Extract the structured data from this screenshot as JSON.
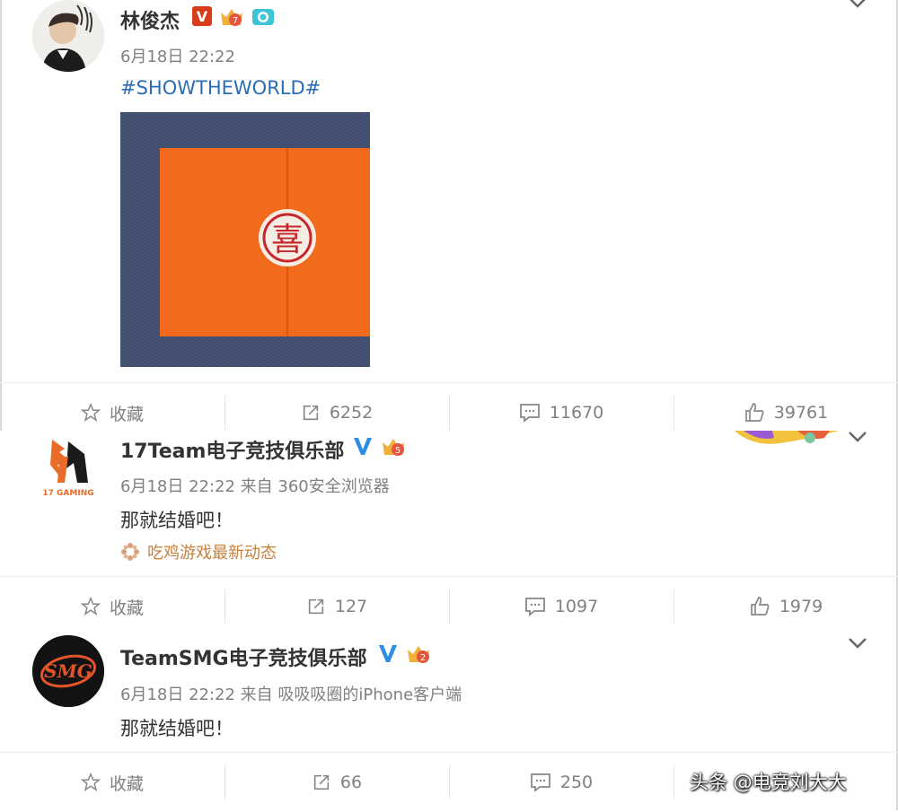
{
  "posts": [
    {
      "author": "林俊杰",
      "time": "6月18日 22:22",
      "source": "",
      "text": "#SHOWTHEWORLD#",
      "image_caption": "喜",
      "actions": {
        "favorite": "收藏",
        "repost": "6252",
        "comment": "11670",
        "like": "39761"
      },
      "level": "7"
    },
    {
      "author": "17Team电子竞技俱乐部",
      "time": "6月18日 22:22 来自 360安全浏览器",
      "text": "那就结婚吧！",
      "topic": "吃鸡游戏最新动态",
      "avatar_label": "17 GAMING",
      "actions": {
        "favorite": "收藏",
        "repost": "127",
        "comment": "1097",
        "like": "1979"
      },
      "level": "5"
    },
    {
      "author": "TeamSMG电子竞技俱乐部",
      "time": "6月18日 22:22 来自 吸吸吸圈的iPhone客户端",
      "text": "那就结婚吧！",
      "avatar_label": "SMG",
      "actions": {
        "favorite": "收藏",
        "repost": "66",
        "comment": "250"
      },
      "level": "2"
    }
  ],
  "badges": {
    "v": "V"
  },
  "watermark": "头条 @电竞刘大大",
  "colors": {
    "accent_link": "#2b6cb5",
    "topic": "#c77f3a",
    "verified": "#2b8de4",
    "vip": "#d93c1b"
  }
}
